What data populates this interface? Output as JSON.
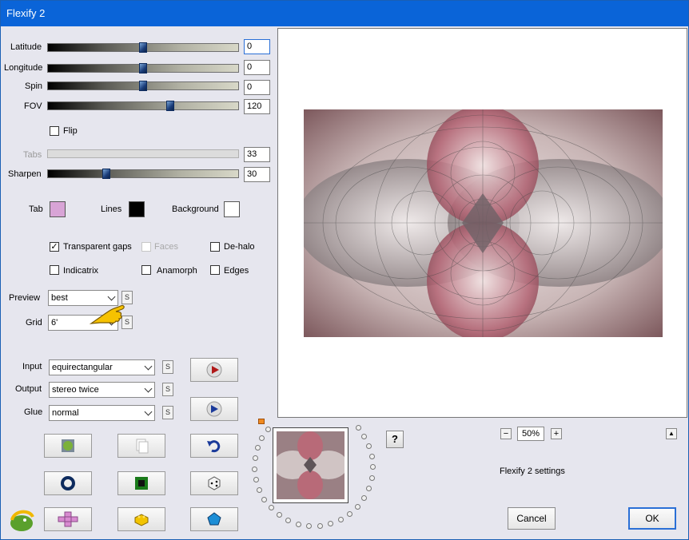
{
  "window": {
    "title": "Flexify 2"
  },
  "sliders": {
    "latitude": {
      "label": "Latitude",
      "value": "0"
    },
    "longitude": {
      "label": "Longitude",
      "value": "0"
    },
    "spin": {
      "label": "Spin",
      "value": "0"
    },
    "fov": {
      "label": "FOV",
      "value": "120"
    },
    "tabs": {
      "label": "Tabs",
      "value": "33"
    },
    "sharpen": {
      "label": "Sharpen",
      "value": "30"
    }
  },
  "slider_levels": {
    "latitude": 0.5,
    "longitude": 0.5,
    "spin": 0.5,
    "fov": 0.65,
    "sharpen": 0.3
  },
  "flip": {
    "label": "Flip",
    "checked": false
  },
  "colors": {
    "tab_label": "Tab",
    "tab": "#d8a4d6",
    "lines_label": "Lines",
    "lines": "#000000",
    "background_label": "Background",
    "background": "#ffffff"
  },
  "options": {
    "transparent_gaps": {
      "label": "Transparent gaps",
      "checked": true,
      "mark": "✓"
    },
    "faces": {
      "label": "Faces",
      "checked": false
    },
    "de_halo": {
      "label": "De-halo",
      "checked": false
    },
    "indicatrix": {
      "label": "Indicatrix",
      "checked": false
    },
    "anamorph": {
      "label": "Anamorph",
      "checked": false
    },
    "edges": {
      "label": "Edges",
      "checked": false
    }
  },
  "preview_select": {
    "label": "Preview",
    "value": "best",
    "s": "S"
  },
  "grid_select": {
    "label": "Grid",
    "value": "6'",
    "s": "S"
  },
  "input_select": {
    "label": "Input",
    "value": "equirectangular",
    "s": "S"
  },
  "output_select": {
    "label": "Output",
    "value": "stereo twice",
    "s": "S"
  },
  "glue_select": {
    "label": "Glue",
    "value": "normal",
    "s": "S"
  },
  "zoom": {
    "minus": "−",
    "value": "50%",
    "plus": "+"
  },
  "up_arrow": "▲",
  "help": "?",
  "status": "Flexify 2 settings",
  "buttons": {
    "cancel": "Cancel",
    "ok": "OK"
  }
}
